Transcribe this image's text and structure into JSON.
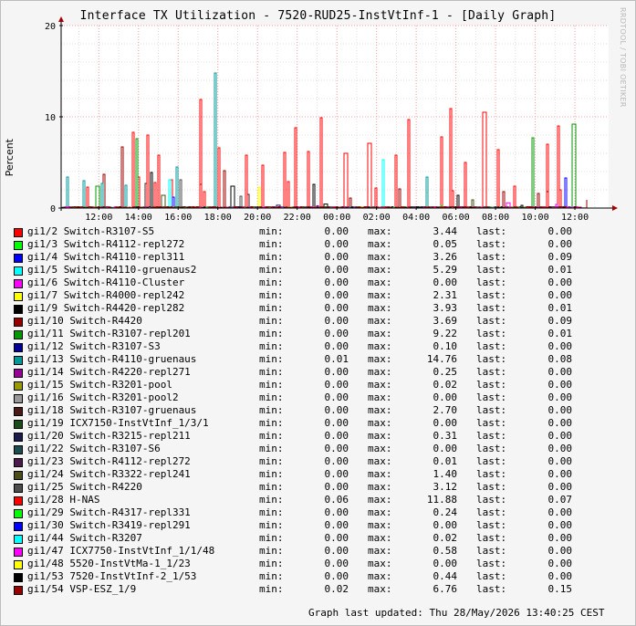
{
  "title": "Interface TX Utilization - 7520-RUD25-InstVtInf-1 - [Daily Graph]",
  "watermark": "RRDTOOL / TOBI OETIKER",
  "updated": "Graph last updated: Thu 28/May/2026 13:40:25 CEST",
  "colors": {
    "background": "#f5f5f5",
    "canvas": "#ffffff",
    "grid_major": "#ff9e9e",
    "axis": "#000000",
    "arrow": "#a00000"
  },
  "labels": {
    "min": "min:",
    "max": "max:",
    "last": "last:"
  },
  "chart_data": {
    "type": "line",
    "title": "Interface TX Utilization - 7520-RUD25-InstVtInf-1 - [Daily Graph]",
    "xlabel": "",
    "ylabel": "Percent",
    "ylim": [
      0,
      20
    ],
    "y_ticks": [
      "0",
      "10",
      "20"
    ],
    "y_tick_values": [
      0,
      10,
      20
    ],
    "x_ticks": [
      "12:00",
      "14:00",
      "16:00",
      "18:00",
      "20:00",
      "22:00",
      "00:00",
      "02:00",
      "04:00",
      "06:00",
      "08:00",
      "10:00",
      "12:00"
    ],
    "x_tick_hours": [
      -24,
      -22,
      -20,
      -18,
      -16,
      -14,
      -12,
      -10,
      -8,
      -6,
      -4,
      -2,
      0
    ],
    "xlim_hours": [
      -25.9,
      1.7
    ],
    "grid": true,
    "legend_position": "bottom",
    "series": [
      {
        "name": "gi1/2 Switch-R3107-S5",
        "color": "#ff0000",
        "min": "0.00",
        "max": "3.44",
        "last": "0.00",
        "spikes": [
          [
            -24.6,
            2.3
          ],
          [
            -22.0,
            3.4
          ],
          [
            -21.2,
            2.8
          ],
          [
            -20.4,
            3.1
          ],
          [
            -18.7,
            1.8
          ],
          [
            -14.5,
            2.9
          ],
          [
            -10.1,
            2.2
          ],
          [
            -6.2,
            1.9
          ],
          [
            -3.1,
            2.4
          ],
          [
            -0.8,
            2.0
          ]
        ]
      },
      {
        "name": "gi1/3 Switch-R4112-repl272",
        "color": "#00ff00",
        "min": "0.00",
        "max": "0.05",
        "last": "0.00",
        "spikes": [
          [
            -23.0,
            0.05
          ],
          [
            -12.0,
            0.04
          ]
        ]
      },
      {
        "name": "gi1/4 Switch-R4110-repl311",
        "color": "#0000ff",
        "min": "0.00",
        "max": "3.26",
        "last": "0.09",
        "spikes": [
          [
            -20.3,
            1.2
          ],
          [
            -0.5,
            3.3
          ]
        ]
      },
      {
        "name": "gi1/5 Switch-R4110-gruenaus2",
        "color": "#00ffff",
        "min": "0.00",
        "max": "5.29",
        "last": "0.01",
        "spikes": [
          [
            -20.5,
            3.1
          ],
          [
            -9.7,
            5.3
          ]
        ]
      },
      {
        "name": "gi1/6 Switch-R4110-Cluster",
        "color": "#ff00ff",
        "min": "0.00",
        "max": "0.00",
        "last": "0.00",
        "spikes": []
      },
      {
        "name": "gi1/7 Switch-R4000-repl242",
        "color": "#ffff00",
        "min": "0.00",
        "max": "2.31",
        "last": "0.00",
        "spikes": [
          [
            -16.0,
            2.3
          ],
          [
            -7.5,
            1.7
          ]
        ]
      },
      {
        "name": "gi1/9 Switch-R4420-repl282",
        "color": "#000000",
        "min": "0.00",
        "max": "3.93",
        "last": "0.01",
        "spikes": [
          [
            -21.4,
            3.9
          ],
          [
            -17.3,
            2.4
          ],
          [
            -13.2,
            2.6
          ],
          [
            -5.9,
            1.4
          ],
          [
            -1.4,
            1.8
          ]
        ]
      },
      {
        "name": "gi1/10 Switch-R4420",
        "color": "#990000",
        "min": "0.00",
        "max": "3.69",
        "last": "0.09",
        "spikes": [
          [
            -23.8,
            3.7
          ],
          [
            -18.9,
            2.6
          ],
          [
            -11.4,
            1.1
          ],
          [
            -1.9,
            1.6
          ]
        ]
      },
      {
        "name": "gi1/11 Switch-R3107-repl201",
        "color": "#009900",
        "min": "0.00",
        "max": "9.22",
        "last": "0.01",
        "spikes": [
          [
            -24.1,
            2.4
          ],
          [
            -22.1,
            7.6
          ],
          [
            -2.2,
            7.7
          ],
          [
            -0.1,
            9.2
          ]
        ]
      },
      {
        "name": "gi1/12 Switch-R3107-S3",
        "color": "#000099",
        "min": "0.00",
        "max": "0.10",
        "last": "0.00",
        "spikes": [
          [
            -19.5,
            0.1
          ]
        ]
      },
      {
        "name": "gi1/13 Switch-R4110-gruenaus",
        "color": "#009999",
        "min": "0.01",
        "max": "14.76",
        "last": "0.08",
        "spikes": [
          [
            -25.6,
            3.4
          ],
          [
            -24.8,
            3.0
          ],
          [
            -23.9,
            2.7
          ],
          [
            -22.7,
            2.5
          ],
          [
            -20.1,
            4.5
          ],
          [
            -18.2,
            14.8
          ],
          [
            -7.5,
            3.4
          ]
        ]
      },
      {
        "name": "gi1/14 Switch-R4220-repl271",
        "color": "#990099",
        "min": "0.00",
        "max": "0.25",
        "last": "0.00",
        "spikes": [
          [
            -13.0,
            0.25
          ]
        ]
      },
      {
        "name": "gi1/15 Switch-R3201-pool",
        "color": "#999900",
        "min": "0.00",
        "max": "0.02",
        "last": "0.00",
        "spikes": [
          [
            -9.0,
            0.02
          ]
        ]
      },
      {
        "name": "gi1/16 Switch-R3201-pool2",
        "color": "#999999",
        "min": "0.00",
        "max": "0.00",
        "last": "0.00",
        "spikes": []
      },
      {
        "name": "gi1/18 Switch-R3107-gruenaus",
        "color": "#4d1a1a",
        "min": "0.00",
        "max": "2.70",
        "last": "0.00",
        "spikes": [
          [
            -21.7,
            2.7
          ],
          [
            -16.5,
            1.5
          ]
        ]
      },
      {
        "name": "gi1/19 ICX7150-InstVtInf_1/3/1",
        "color": "#1a4d1a",
        "min": "0.00",
        "max": "0.00",
        "last": "0.00",
        "spikes": []
      },
      {
        "name": "gi1/20 Switch-R3215-repl211",
        "color": "#1a1a4d",
        "min": "0.00",
        "max": "0.31",
        "last": "0.00",
        "spikes": [
          [
            -15.0,
            0.31
          ]
        ]
      },
      {
        "name": "gi1/22 Switch-R3107-S6",
        "color": "#1a4d4d",
        "min": "0.00",
        "max": "0.00",
        "last": "0.00",
        "spikes": []
      },
      {
        "name": "gi1/23 Switch-R4112-repl272",
        "color": "#4d1a4d",
        "min": "0.00",
        "max": "0.01",
        "last": "0.00",
        "spikes": [
          [
            -10.5,
            0.01
          ]
        ]
      },
      {
        "name": "gi1/24 Switch-R3322-repl241",
        "color": "#4d4d1a",
        "min": "0.00",
        "max": "1.40",
        "last": "0.00",
        "spikes": [
          [
            -20.8,
            1.4
          ],
          [
            -5.2,
            0.9
          ]
        ]
      },
      {
        "name": "gi1/25 Switch-R4220",
        "color": "#4d4d4d",
        "min": "0.00",
        "max": "3.12",
        "last": "0.00",
        "spikes": [
          [
            -19.9,
            3.1
          ],
          [
            -16.9,
            1.3
          ]
        ]
      },
      {
        "name": "gi1/28 H-NAS",
        "color": "#ff0000",
        "min": "0.06",
        "max": "11.88",
        "last": "0.07",
        "spikes": [
          [
            -22.3,
            8.3
          ],
          [
            -21.6,
            8.0
          ],
          [
            -21.0,
            5.8
          ],
          [
            -18.9,
            11.9
          ],
          [
            -18.0,
            6.6
          ],
          [
            -16.6,
            5.8
          ],
          [
            -15.8,
            4.7
          ],
          [
            -14.7,
            6.1
          ],
          [
            -14.1,
            8.8
          ],
          [
            -13.5,
            6.2
          ],
          [
            -12.8,
            9.9
          ],
          [
            -11.6,
            6.0
          ],
          [
            -10.4,
            7.1
          ],
          [
            -9.1,
            5.8
          ],
          [
            -8.4,
            9.7
          ],
          [
            -6.8,
            7.8
          ],
          [
            -6.3,
            10.9
          ],
          [
            -5.6,
            5.0
          ],
          [
            -4.6,
            10.5
          ],
          [
            -3.9,
            6.4
          ],
          [
            -1.4,
            7.0
          ],
          [
            -0.9,
            9.0
          ]
        ]
      },
      {
        "name": "gi1/29 Switch-R4317-repl331",
        "color": "#00ff00",
        "min": "0.00",
        "max": "0.24",
        "last": "0.00",
        "spikes": [
          [
            -6.8,
            0.24
          ]
        ]
      },
      {
        "name": "gi1/30 Switch-R3419-repl291",
        "color": "#0000ff",
        "min": "0.00",
        "max": "0.00",
        "last": "0.00",
        "spikes": []
      },
      {
        "name": "gi1/44 Switch-R3207",
        "color": "#00ffff",
        "min": "0.00",
        "max": "0.02",
        "last": "0.00",
        "spikes": [
          [
            -4.2,
            0.02
          ]
        ]
      },
      {
        "name": "gi1/47 ICX7750-InstVtInf_1/1/48",
        "color": "#ff00ff",
        "min": "0.00",
        "max": "0.58",
        "last": "0.00",
        "spikes": [
          [
            -3.4,
            0.58
          ],
          [
            -1.0,
            0.4
          ]
        ]
      },
      {
        "name": "gi1/48 5520-InstVtMa-1_1/23",
        "color": "#ffff00",
        "min": "0.00",
        "max": "0.00",
        "last": "0.00",
        "spikes": []
      },
      {
        "name": "gi1/53 7520-InstVtInf-2_1/53",
        "color": "#000000",
        "min": "0.00",
        "max": "0.44",
        "last": "0.00",
        "spikes": [
          [
            -12.6,
            0.44
          ],
          [
            -2.7,
            0.3
          ]
        ]
      },
      {
        "name": "gi1/54 VSP-ESZ_1/9",
        "color": "#990000",
        "min": "0.02",
        "max": "6.76",
        "last": "0.15",
        "spikes": [
          [
            -22.9,
            6.7
          ],
          [
            -17.7,
            4.1
          ],
          [
            -8.9,
            2.1
          ],
          [
            -3.6,
            1.8
          ],
          [
            0.6,
            0.9
          ]
        ]
      }
    ]
  }
}
